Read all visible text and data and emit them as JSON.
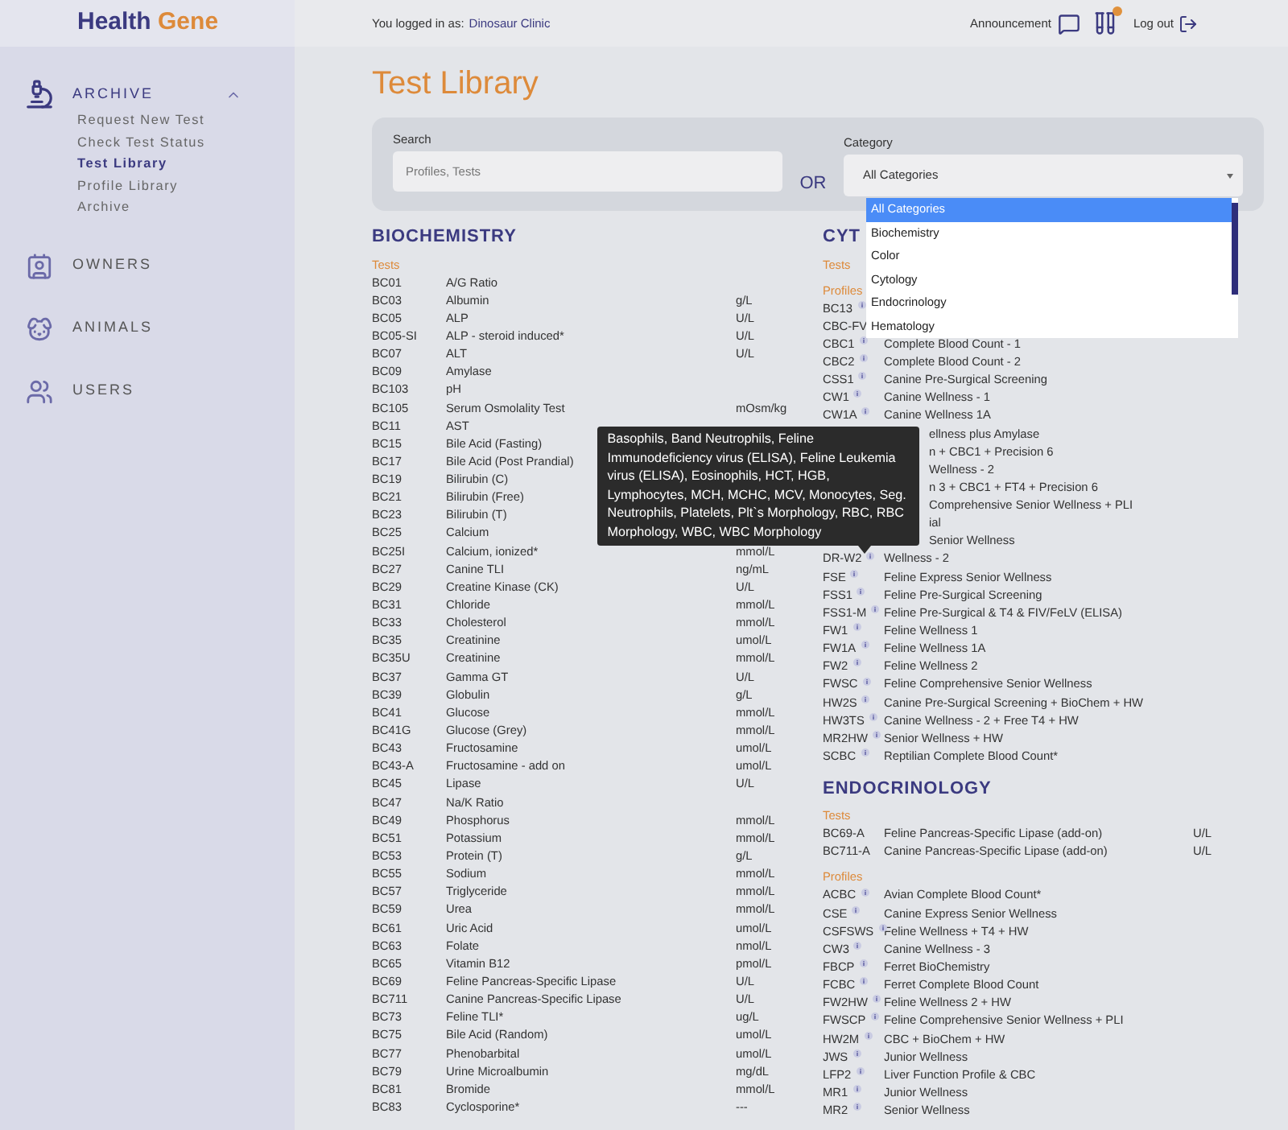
{
  "brand": {
    "first": "Health",
    "second": "Gene"
  },
  "header": {
    "login_label": "You logged in as:",
    "clinic": "Dinosaur Clinic",
    "announcement": "Announcement",
    "logout": "Log out"
  },
  "sidebar": {
    "items": [
      {
        "label": "ARCHIVE",
        "expanded": true,
        "children": [
          {
            "label": "Request New Test",
            "selected": false
          },
          {
            "label": "Check Test Status",
            "selected": false
          },
          {
            "label": "Test Library",
            "selected": true
          },
          {
            "label": "Profile Library",
            "selected": false
          },
          {
            "label": "Archive",
            "selected": false
          }
        ]
      },
      {
        "label": "OWNERS"
      },
      {
        "label": "ANIMALS"
      },
      {
        "label": "USERS"
      }
    ]
  },
  "page_title": "Test Library",
  "filters": {
    "search_label": "Search",
    "search_placeholder": "Profiles, Tests",
    "or": "OR",
    "category_label": "Category",
    "category_value": "All Categories",
    "dropdown": {
      "open": true,
      "options": [
        {
          "label": "All Categories",
          "selected": true
        },
        {
          "label": "Biochemistry",
          "selected": false
        },
        {
          "label": "Color",
          "selected": false
        },
        {
          "label": "Cytology",
          "selected": false
        },
        {
          "label": "Endocrinology",
          "selected": false
        },
        {
          "label": "Hematology",
          "selected": false
        }
      ]
    }
  },
  "sections": [
    {
      "title": "BIOCHEMISTRY",
      "tests_label": "Tests",
      "tests": [
        {
          "code": "BC01",
          "name": "A/G Ratio"
        },
        {
          "code": "BC03",
          "name": "Albumin",
          "unit": "g/L"
        },
        {
          "code": "BC05",
          "name": "ALP",
          "unit": "U/L"
        },
        {
          "code": "BC05-SI",
          "name": "ALP - steroid induced*",
          "unit": "U/L"
        },
        {
          "code": "BC07",
          "name": "ALT",
          "unit": "U/L"
        },
        {
          "code": "BC09",
          "name": "Amylase"
        },
        {
          "code": "BC103",
          "name": "pH"
        },
        {
          "code": "BC105",
          "name": "Serum Osmolality Test",
          "unit": "mOsm/kg"
        },
        {
          "code": "BC11",
          "name": "AST"
        },
        {
          "code": "BC15",
          "name": "Bile Acid (Fasting)"
        },
        {
          "code": "BC17",
          "name": "Bile Acid (Post Prandial)"
        },
        {
          "code": "BC19",
          "name": "Bilirubin (C)"
        },
        {
          "code": "BC21",
          "name": "Bilirubin (Free)"
        },
        {
          "code": "BC23",
          "name": "Bilirubin (T)"
        },
        {
          "code": "BC25",
          "name": "Calcium"
        },
        {
          "code": "BC25I",
          "name": "Calcium, ionized*",
          "unit": "mmol/L"
        },
        {
          "code": "BC27",
          "name": "Canine TLI",
          "unit": "ng/mL"
        },
        {
          "code": "BC29",
          "name": "Creatine Kinase (CK)",
          "unit": "U/L"
        },
        {
          "code": "BC31",
          "name": "Chloride",
          "unit": "mmol/L"
        },
        {
          "code": "BC33",
          "name": "Cholesterol",
          "unit": "mmol/L"
        },
        {
          "code": "BC35",
          "name": "Creatinine",
          "unit": "umol/L"
        },
        {
          "code": "BC35U",
          "name": "Creatinine",
          "unit": "mmol/L"
        },
        {
          "code": "BC37",
          "name": "Gamma GT",
          "unit": "U/L"
        },
        {
          "code": "BC39",
          "name": "Globulin",
          "unit": "g/L"
        },
        {
          "code": "BC41",
          "name": "Glucose",
          "unit": "mmol/L"
        },
        {
          "code": "BC41G",
          "name": "Glucose (Grey)",
          "unit": "mmol/L"
        },
        {
          "code": "BC43",
          "name": "Fructosamine",
          "unit": "umol/L"
        },
        {
          "code": "BC43-A",
          "name": "Fructosamine - add on",
          "unit": "umol/L"
        },
        {
          "code": "BC45",
          "name": "Lipase",
          "unit": "U/L"
        },
        {
          "code": "BC47",
          "name": "Na/K Ratio"
        },
        {
          "code": "BC49",
          "name": "Phosphorus",
          "unit": "mmol/L"
        },
        {
          "code": "BC51",
          "name": "Potassium",
          "unit": "mmol/L"
        },
        {
          "code": "BC53",
          "name": "Protein (T)",
          "unit": "g/L"
        },
        {
          "code": "BC55",
          "name": "Sodium",
          "unit": "mmol/L"
        },
        {
          "code": "BC57",
          "name": "Triglyceride",
          "unit": "mmol/L"
        },
        {
          "code": "BC59",
          "name": "Urea",
          "unit": "mmol/L"
        },
        {
          "code": "BC61",
          "name": "Uric Acid",
          "unit": "umol/L"
        },
        {
          "code": "BC63",
          "name": "Folate",
          "unit": "nmol/L"
        },
        {
          "code": "BC65",
          "name": "Vitamin B12",
          "unit": "pmol/L"
        },
        {
          "code": "BC69",
          "name": "Feline Pancreas-Specific Lipase",
          "unit": "U/L"
        },
        {
          "code": "BC711",
          "name": "Canine Pancreas-Specific Lipase",
          "unit": "U/L"
        },
        {
          "code": "BC73",
          "name": "Feline TLI*",
          "unit": "ug/L"
        },
        {
          "code": "BC75",
          "name": "Bile Acid (Random)",
          "unit": "umol/L"
        },
        {
          "code": "BC77",
          "name": "Phenobarbital",
          "unit": "umol/L"
        },
        {
          "code": "BC79",
          "name": "Urine Microalbumin",
          "unit": "mg/dL"
        },
        {
          "code": "BC81",
          "name": "Bromide",
          "unit": "mmol/L"
        },
        {
          "code": "BC83",
          "name": "Cyclosporine*",
          "unit": "---"
        }
      ]
    },
    {
      "title": "CYT",
      "tests_label": "Tests",
      "profiles_label": "Profiles",
      "profiles": [
        {
          "code": "BC13"
        },
        {
          "code": "CBC-FV",
          "info": false
        },
        {
          "code": "CBC1",
          "name": "Complete Blood Count - 1"
        },
        {
          "code": "CBC2",
          "name": "Complete Blood Count - 2"
        },
        {
          "code": "CSS1",
          "name": "Canine Pre-Surgical Screening"
        },
        {
          "code": "CW1",
          "name": "Canine Wellness - 1"
        },
        {
          "code": "CW1A",
          "name": "Canine Wellness 1A"
        },
        {
          "name": "ellness plus Amylase"
        },
        {
          "name": "n + CBC1 + Precision 6"
        },
        {
          "name": "Wellness - 2"
        },
        {
          "name": "n 3 + CBC1 + FT4 + Precision 6"
        },
        {
          "name": "Comprehensive Senior Wellness + PLI"
        },
        {
          "name": "ial"
        },
        {
          "name": "Senior Wellness"
        },
        {
          "code": "DR-W2",
          "name": "Wellness - 2",
          "tooltip": "Basophils, Band Neutrophils, Feline Immunodeficiency virus (ELISA), Feline Leukemia virus (ELISA), Eosinophils, HCT, HGB, Lymphocytes, MCH, MCHC, MCV, Monocytes, Seg. Neutrophils, Platelets, Plt`s Morphology, RBC, RBC Morphology, WBC, WBC Morphology"
        },
        {
          "code": "FSE",
          "name": "Feline Express Senior Wellness"
        },
        {
          "code": "FSS1",
          "name": "Feline Pre-Surgical Screening"
        },
        {
          "code": "FSS1-M",
          "name": "Feline Pre-Surgical & T4 & FIV/FeLV (ELISA)"
        },
        {
          "code": "FW1",
          "name": "Feline Wellness 1"
        },
        {
          "code": "FW1A",
          "name": "Feline Wellness 1A"
        },
        {
          "code": "FW2",
          "name": "Feline Wellness 2"
        },
        {
          "code": "FWSC",
          "name": "Feline Comprehensive Senior Wellness"
        },
        {
          "code": "HW2S",
          "name": "Canine Pre-Surgical Screening + BioChem + HW"
        },
        {
          "code": "HW3TS",
          "name": "Canine Wellness - 2 + Free T4 + HW"
        },
        {
          "code": "MR2HW",
          "name": "Senior Wellness + HW"
        },
        {
          "code": "SCBC",
          "name": "Reptilian Complete Blood Count*"
        }
      ]
    },
    {
      "title": "ENDOCRINOLOGY",
      "tests_label": "Tests",
      "tests": [
        {
          "code": "BC69-A",
          "name": "Feline Pancreas-Specific Lipase (add-on)",
          "unit": "U/L"
        },
        {
          "code": "BC711-A",
          "name": "Canine Pancreas-Specific Lipase (add-on)",
          "unit": "U/L"
        }
      ],
      "profiles_label": "Profiles",
      "profiles": [
        {
          "code": "ACBC",
          "name": "Avian Complete Blood Count*"
        },
        {
          "code": "CSE",
          "name": "Canine Express Senior Wellness"
        },
        {
          "code": "CSFSWS",
          "name": "Feline Wellness + T4 + HW"
        },
        {
          "code": "CW3",
          "name": "Canine Wellness - 3"
        },
        {
          "code": "FBCP",
          "name": "Ferret BioChemistry"
        },
        {
          "code": "FCBC",
          "name": "Ferret Complete Blood Count"
        },
        {
          "code": "FW2HW",
          "name": "Feline Wellness 2 + HW"
        },
        {
          "code": "FWSCP",
          "name": "Feline Comprehensive Senior Wellness + PLI"
        },
        {
          "code": "HW2M",
          "name": "CBC + BioChem + HW"
        },
        {
          "code": "JWS",
          "name": "Junior Wellness"
        },
        {
          "code": "LFP2",
          "name": "Liver Function Profile & CBC"
        },
        {
          "code": "MR1",
          "name": "Junior Wellness"
        },
        {
          "code": "MR2",
          "name": "Senior Wellness"
        }
      ]
    }
  ]
}
